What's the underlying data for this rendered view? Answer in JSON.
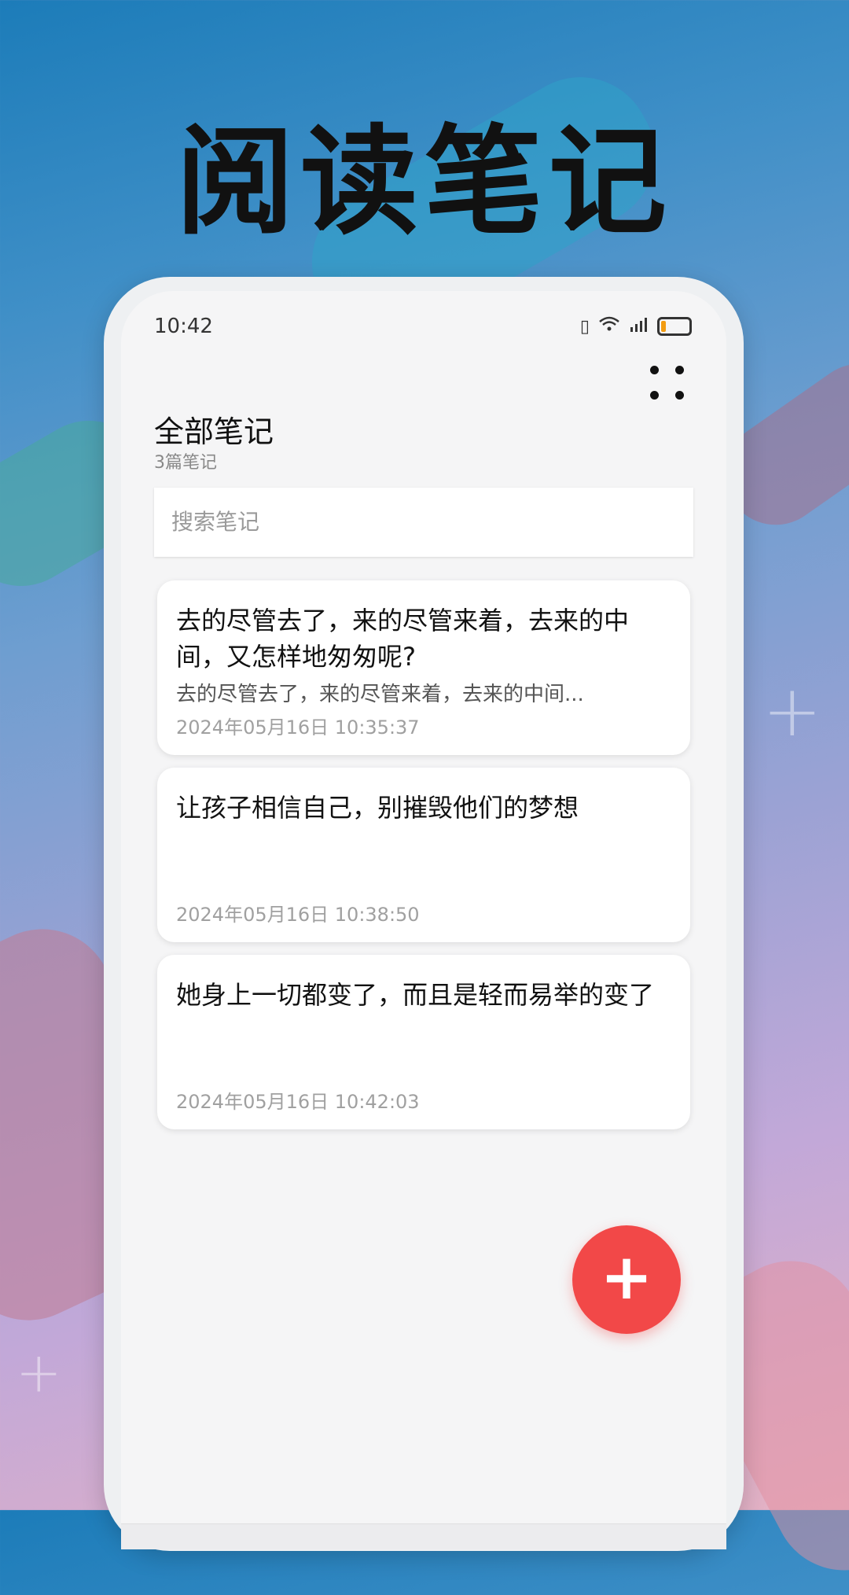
{
  "promo": {
    "headline": "阅读笔记"
  },
  "status_bar": {
    "time": "10:42",
    "icons": [
      "vibrate-icon",
      "wifi-icon",
      "signal-icon",
      "battery-icon"
    ]
  },
  "header": {
    "title": "全部笔记",
    "subtitle": "3篇笔记",
    "more_icon": "more-grid-icon"
  },
  "search": {
    "placeholder": "搜索笔记",
    "value": ""
  },
  "notes": [
    {
      "title": "去的尽管去了，来的尽管来着，去来的中间，又怎样地匆匆呢?",
      "preview": "去的尽管去了，来的尽管来着，去来的中间...",
      "date": "2024年05月16日 10:35:37"
    },
    {
      "title": "让孩子相信自己，别摧毁他们的梦想",
      "preview": "",
      "date": "2024年05月16日 10:38:50"
    },
    {
      "title": "她身上一切都变了，而且是轻而易举的变了",
      "preview": "",
      "date": "2024年05月16日 10:42:03"
    }
  ],
  "fab": {
    "label": "+",
    "color": "#f24848"
  }
}
